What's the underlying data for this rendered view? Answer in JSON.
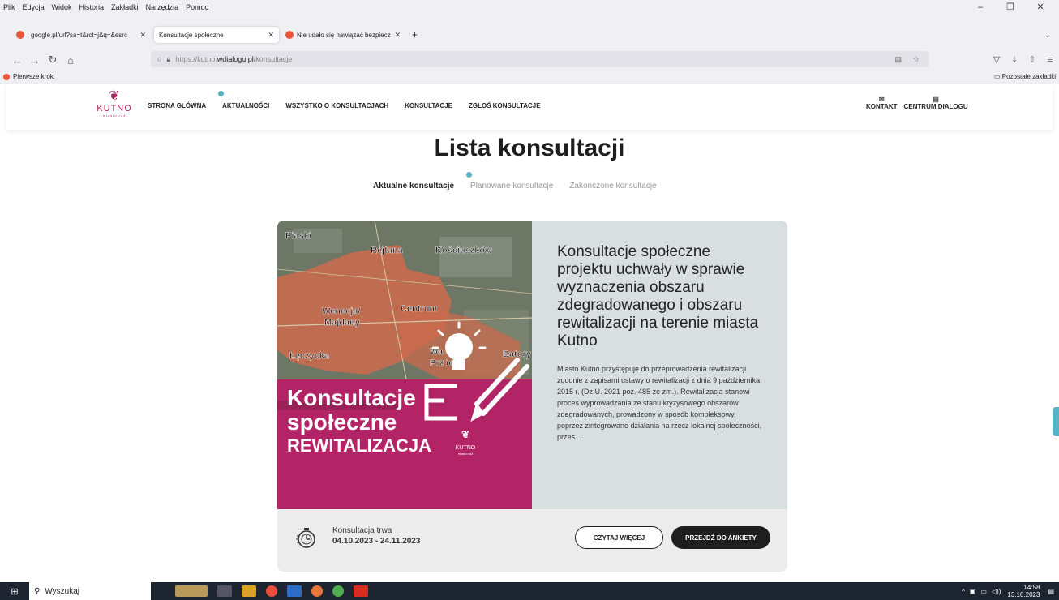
{
  "browser": {
    "menu": [
      "Plik",
      "Edycja",
      "Widok",
      "Historia",
      "Zakładki",
      "Narzędzia",
      "Pomoc"
    ],
    "window_controls": [
      "–",
      "❐",
      "✕"
    ],
    "tabs": [
      {
        "label": "google.pl/url?sa=t&rct=j&q=&esrc",
        "active": false
      },
      {
        "label": "Konsultacje społeczne",
        "active": true
      },
      {
        "label": "Nie udało się nawiązać bezpiecz",
        "active": false
      }
    ],
    "new_tab": "+",
    "tab_close": "✕",
    "url_prefix": "https://kutno.",
    "url_domain": "wdialogu.pl",
    "url_path": "/konsultacje",
    "bookmark": "Pierwsze kroki",
    "other_bookmarks": "Pozostałe zakładki"
  },
  "site": {
    "logo": {
      "name": "KUTNO",
      "sub": "miasto róż",
      "mark": "❦"
    },
    "menu": [
      "STRONA GŁÓWNA",
      "AKTUALNOŚCI",
      "WSZYSTKO O KONSULTACJACH",
      "KONSULTACJE",
      "ZGŁOŚ KONSULTACJE"
    ],
    "right": [
      {
        "label": "KONTAKT",
        "icon": "✉"
      },
      {
        "label": "CENTRUM DIALOGU",
        "icon": "▤"
      }
    ],
    "accent": "#5ab3c4",
    "brand": "#b3245e"
  },
  "main": {
    "title": "Lista konsultacji",
    "subtabs": [
      "Aktualne konsultacje",
      "Planowane konsultacje",
      "Zakończone konsultacje"
    ],
    "card": {
      "image": {
        "places": [
          "Piaski",
          "Rejtana",
          "Kościuszków",
          "Wenecja/\nMajdany",
          "Centrum",
          "Łęczycka",
          "Wa...skie\nPrzedm...ie",
          "Batory"
        ],
        "banner_line1": "Konsultacje",
        "banner_line2": "społeczne",
        "banner_line3": "REWITALIZACJA",
        "logo_name": "KUTNO",
        "logo_sub": "miasto róż"
      },
      "title": "Konsultacje społeczne projektu uchwały w sprawie wyznaczenia obszaru zdegradowanego i obszaru rewitalizacji na terenie miasta Kutno",
      "description": "Miasto Kutno przystępuje do przeprowadzenia rewitalizacji zgodnie z zapisami ustawy o rewitalizacji z dnia 9 października 2015 r. (Dz.U. 2021 poz. 485 ze zm.). Rewitalizacja stanowi proces wyprowadzania ze stanu kryzysowego obszarów zdegradowanych, prowadzony w sposób kompleksowy, poprzez zintegrowane działania na rzecz lokalnej społeczności, przes...",
      "duration_label": "Konsultacja trwa",
      "duration_dates": "04.10.2023 - 24.11.2023",
      "read_more": "CZYTAJ WIĘCEJ",
      "go_survey": "PRZEJDŹ DO ANKIETY"
    }
  },
  "taskbar": {
    "search": "Wyszukaj",
    "time": "14:58",
    "date": "13.10.2023"
  }
}
